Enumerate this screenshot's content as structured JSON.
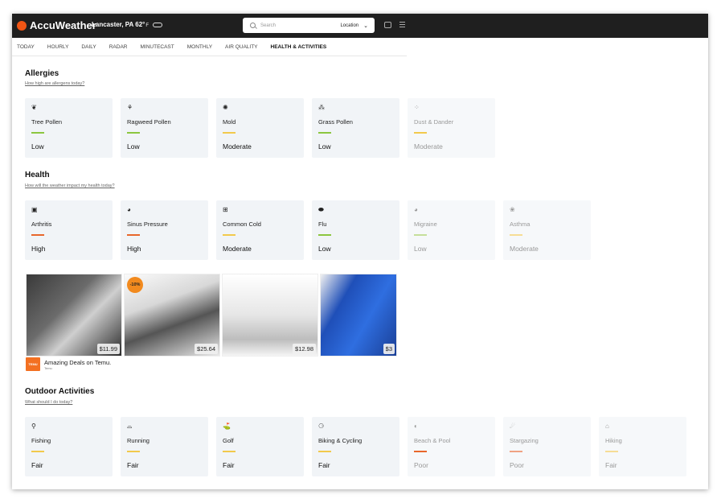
{
  "header": {
    "brand": "AccuWeather",
    "location": "Lancaster, PA",
    "temp": "62°",
    "temp_unit": "F",
    "search_placeholder": "Search",
    "search_scope": "Location",
    "colors": {
      "bar": "#1f1f1f",
      "brand": "#f05514"
    }
  },
  "tabs": [
    "TODAY",
    "HOURLY",
    "DAILY",
    "RADAR",
    "MINUTECAST",
    "MONTHLY",
    "AIR QUALITY",
    "HEALTH & ACTIVITIES"
  ],
  "allergies": {
    "title": "Allergies",
    "link": "How high are allergens today?",
    "cards": [
      {
        "name": "Tree Pollen",
        "level": "Low",
        "icon": "tree-pollen-icon",
        "color": "#8cc63f"
      },
      {
        "name": "Ragweed Pollen",
        "level": "Low",
        "icon": "ragweed-icon",
        "color": "#8cc63f"
      },
      {
        "name": "Mold",
        "level": "Moderate",
        "icon": "mold-icon",
        "color": "#f2c94c"
      },
      {
        "name": "Grass Pollen",
        "level": "Low",
        "icon": "grass-icon",
        "color": "#8cc63f"
      },
      {
        "name": "Dust & Dander",
        "level": "Moderate",
        "icon": "dust-icon",
        "color": "#f2c94c"
      }
    ]
  },
  "health": {
    "title": "Health",
    "link": "How will the weather impact my health today?",
    "cards": [
      {
        "name": "Arthritis",
        "level": "High",
        "icon": "arthritis-icon",
        "color": "#e8672b"
      },
      {
        "name": "Sinus Pressure",
        "level": "High",
        "icon": "sinus-icon",
        "color": "#e8672b"
      },
      {
        "name": "Common Cold",
        "level": "Moderate",
        "icon": "cold-icon",
        "color": "#f2c94c"
      },
      {
        "name": "Flu",
        "level": "Low",
        "icon": "flu-icon",
        "color": "#8cc63f"
      },
      {
        "name": "Migraine",
        "level": "Low",
        "icon": "migraine-icon",
        "color": "#c6df9b"
      },
      {
        "name": "Asthma",
        "level": "Moderate",
        "icon": "asthma-icon",
        "color": "#f6dd95"
      }
    ]
  },
  "ad": {
    "prices": [
      "$11.99",
      "$25.64",
      "$12.98",
      "$3"
    ],
    "discount": "-10%",
    "title": "Amazing Deals on Temu.",
    "source": "Temu",
    "logo_text": "TEMU"
  },
  "outdoor": {
    "title": "Outdoor Activities",
    "link": "What should I do today?",
    "cards": [
      {
        "name": "Fishing",
        "level": "Fair",
        "icon": "fishing-icon",
        "color": "#f2c94c"
      },
      {
        "name": "Running",
        "level": "Fair",
        "icon": "running-icon",
        "color": "#f2c94c"
      },
      {
        "name": "Golf",
        "level": "Fair",
        "icon": "golf-icon",
        "color": "#f2c94c"
      },
      {
        "name": "Biking & Cycling",
        "level": "Fair",
        "icon": "bike-icon",
        "color": "#f2c94c"
      },
      {
        "name": "Beach & Pool",
        "level": "Poor",
        "icon": "sunglasses-icon",
        "color": "#e8672b"
      },
      {
        "name": "Stargazing",
        "level": "Poor",
        "icon": "star-icon",
        "color": "#f0a282"
      },
      {
        "name": "Hiking",
        "level": "Fair",
        "icon": "boot-icon",
        "color": "#f6dd95"
      }
    ]
  }
}
